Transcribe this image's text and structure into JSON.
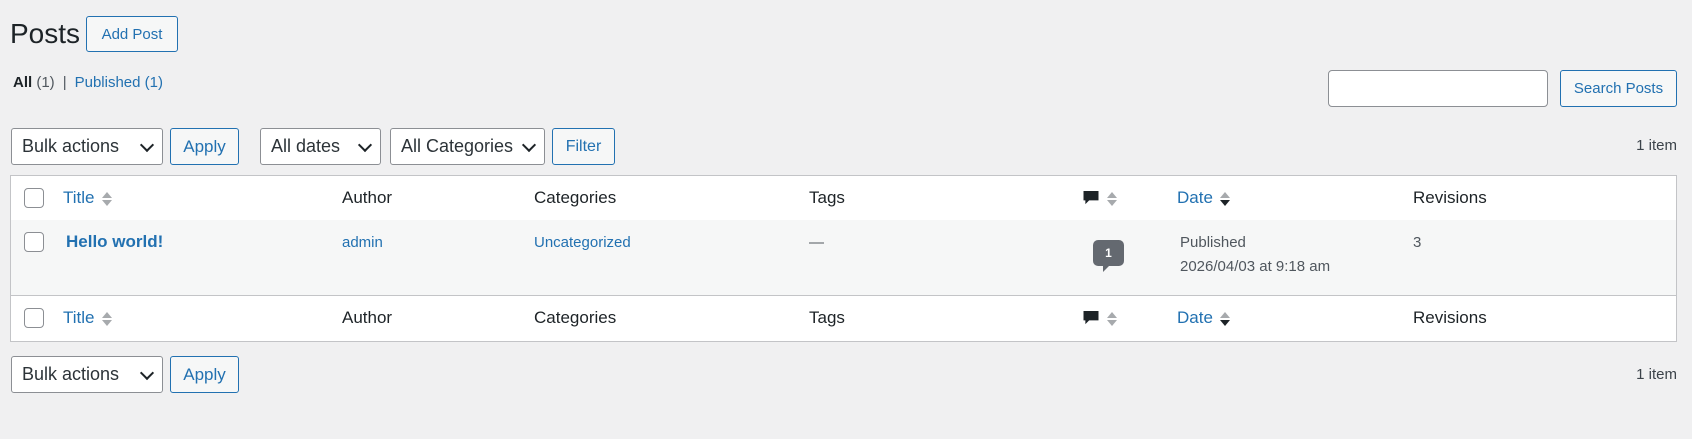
{
  "header": {
    "title": "Posts",
    "add_post_label": "Add Post"
  },
  "views": {
    "all_label": "All",
    "all_count": "(1)",
    "separator": "|",
    "published_label": "Published",
    "published_count": "(1)"
  },
  "search": {
    "placeholder": "",
    "button_label": "Search Posts"
  },
  "tablenav_top": {
    "bulk_actions": "Bulk actions",
    "apply": "Apply",
    "dates": "All dates",
    "categories": "All Categories",
    "filter": "Filter",
    "count": "1 item"
  },
  "table": {
    "columns": {
      "title": "Title",
      "author": "Author",
      "categories": "Categories",
      "tags": "Tags",
      "date": "Date",
      "revisions": "Revisions"
    },
    "rows": [
      {
        "title": "Hello world!",
        "author": "admin",
        "categories": "Uncategorized",
        "tags": "—",
        "comments": "1",
        "date_status": "Published",
        "date": "2026/04/03 at 9:18 am",
        "revisions": "3"
      }
    ]
  },
  "tablenav_bottom": {
    "bulk_actions": "Bulk actions",
    "apply": "Apply",
    "count": "1 item"
  },
  "icons": {
    "comment": "comment-icon",
    "sort": "sort-arrows-icon",
    "chevron": "chevron-down-icon"
  },
  "colors": {
    "link": "#2271b1",
    "background": "#f0f0f1",
    "text": "#1d2327"
  }
}
